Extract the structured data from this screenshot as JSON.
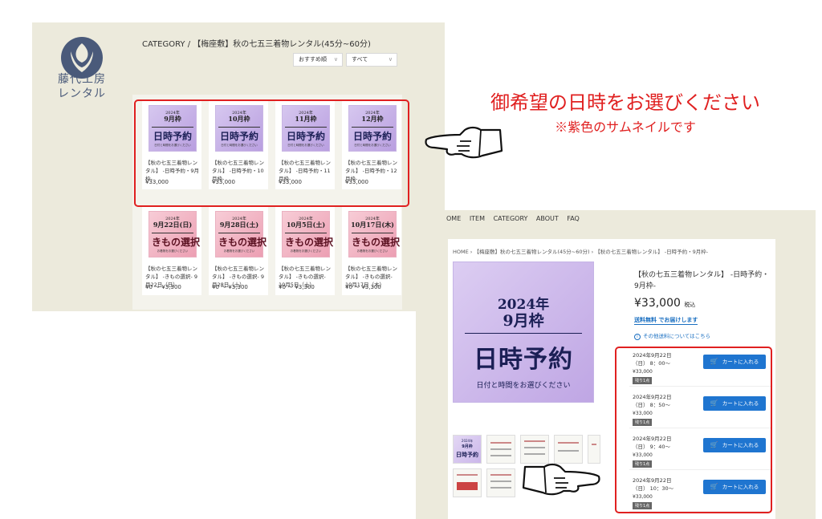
{
  "brand": {
    "logo_name": "藤代工房",
    "logo_sub": "レンタル"
  },
  "listing": {
    "breadcrumb": "CATEGORY / 【梅座敷】秋の七五三着物レンタル(45分~60分)",
    "sort_label": "おすすめ順",
    "filter_label": "すべて",
    "cards_reserve": [
      {
        "l1": "2024年",
        "l2": "9月枠",
        "l3": "日時予約",
        "l4": "日付と時間をお選びください",
        "title": "【秋の七五三着物レンタル】 -日時予約・9月枠-",
        "price": "¥33,000"
      },
      {
        "l1": "2024年",
        "l2": "10月枠",
        "l3": "日時予約",
        "l4": "日付と時間をお選びください",
        "title": "【秋の七五三着物レンタル】 -日時予約・10月枠-",
        "price": "¥33,000"
      },
      {
        "l1": "2024年",
        "l2": "11月枠",
        "l3": "日時予約",
        "l4": "日付と時間をお選びください",
        "title": "【秋の七五三着物レンタル】 -日時予約・11月枠-",
        "price": "¥33,000"
      },
      {
        "l1": "2024年",
        "l2": "12月枠",
        "l3": "日時予約",
        "l4": "日付と時間をお選びください",
        "title": "【秋の七五三着物レンタル】 -日時予約・12月枠-",
        "price": "¥33,000"
      }
    ],
    "cards_kimono": [
      {
        "l1": "2024年",
        "l2": "9月22日(日)",
        "l3": "きもの選択",
        "l4": "お着物をお選びください",
        "title": "【秋の七五三着物レンタル】 -きもの選択- 9月22日（日）",
        "price": "¥0 〜 ¥3,300"
      },
      {
        "l1": "2024年",
        "l2": "9月28日(土)",
        "l3": "きもの選択",
        "l4": "お着物をお選びください",
        "title": "【秋の七五三着物レンタル】 -きもの選択- 9月28日（土）",
        "price": "¥0 〜 ¥3,300"
      },
      {
        "l1": "2024年",
        "l2": "10月5日(土)",
        "l3": "きもの選択",
        "l4": "お着物をお選びください",
        "title": "【秋の七五三着物レンタル】 -きもの選択- 10月5日（土）",
        "price": "¥0 〜 ¥3,300"
      },
      {
        "l1": "2024年",
        "l2": "10月17日(木)",
        "l3": "きもの選択",
        "l4": "お着物をお選びください",
        "title": "【秋の七五三着物レンタル】 -きもの選択- 10月17日（木）",
        "price": "¥0 〜 ¥3,300"
      }
    ]
  },
  "callout": {
    "main": "御希望の日時をお選びください",
    "sub": "※紫色のサムネイルです"
  },
  "product": {
    "nav": [
      "OME",
      "ITEM",
      "CATEGORY",
      "ABOUT",
      "FAQ"
    ],
    "breadcrumb": "HOME  ›  【梅座敷】秋の七五三着物レンタル(45分~60分)  ›  【秋の七五三着物レンタル】 -日時予約・9月枠-",
    "image": {
      "year": "2024年",
      "month": "9月枠",
      "main": "日時予約",
      "sub": "日付と時間をお選びください"
    },
    "thumb_small": {
      "l1": "2024年",
      "l2": "9月枠",
      "l3": "日時予約"
    },
    "title": "【秋の七五三着物レンタル】 -日時予約・9月枠-",
    "price": "¥33,000",
    "tax_label": "税込",
    "shipping_free": "送料無料 でお届けします",
    "shipping_info": "その他送料についてはこちら",
    "cart_label": "カートに入れる",
    "slots": [
      {
        "date": "2024年9月22日",
        "time": "（日） 8：00〜",
        "price": "¥33,000",
        "badge": "残り1点"
      },
      {
        "date": "2024年9月22日",
        "time": "（日） 8：50〜",
        "price": "¥33,000",
        "badge": "残り1点"
      },
      {
        "date": "2024年9月22日",
        "time": "（日） 9：40〜",
        "price": "¥33,000",
        "badge": "残り1点"
      },
      {
        "date": "2024年9月22日",
        "time": "（日） 10：30〜",
        "price": "¥33,000",
        "badge": "残り1点"
      }
    ]
  },
  "colors": {
    "highlight": "#e02020",
    "cart_button": "#1f75d0",
    "reserve_thumb": "#c5b0e8",
    "kimono_thumb": "#f0b3c3",
    "brand_navy": "#1b1f55"
  }
}
